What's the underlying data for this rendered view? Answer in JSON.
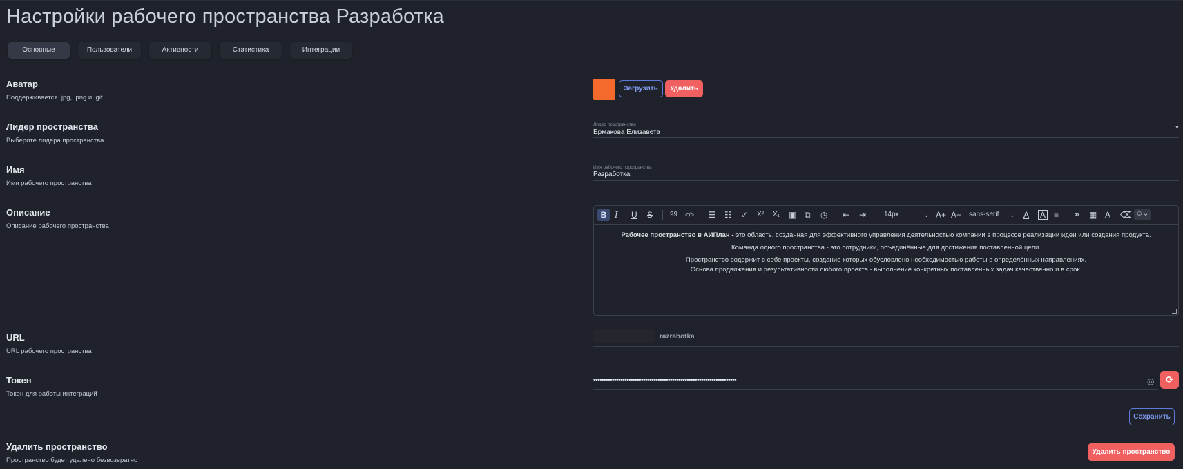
{
  "page": {
    "title": "Настройки рабочего пространства Разработка"
  },
  "tabs": [
    {
      "label": "Основные",
      "active": true
    },
    {
      "label": "Пользователи",
      "active": false
    },
    {
      "label": "Активности",
      "active": false
    },
    {
      "label": "Статистика",
      "active": false
    },
    {
      "label": "Интеграции",
      "active": false
    }
  ],
  "avatar": {
    "title": "Аватар",
    "desc": "Поддерживается .jpg, .png и .gif",
    "color": "#f46a2c",
    "upload_label": "Загрузить",
    "delete_label": "Удалить"
  },
  "leader": {
    "title": "Лидер пространства",
    "desc": "Выберите лидера пространства",
    "field_label": "Лидер пространства",
    "value": "Ермакова Елизавета"
  },
  "name": {
    "title": "Имя",
    "desc": "Имя рабочего пространства",
    "field_label": "Имя рабочего пространства",
    "value": "Разработка"
  },
  "description": {
    "title": "Описание",
    "desc": "Описание рабочего пространства",
    "toolbar": {
      "font_size": "14px",
      "font_family": "sans-serif",
      "icons": [
        "bold-icon",
        "italic-icon",
        "underline-icon",
        "strikethrough-icon",
        "quote-icon",
        "code-icon",
        "bullet-list-icon",
        "numbered-list-icon",
        "checklist-icon",
        "superscript-icon",
        "subscript-icon",
        "image-icon",
        "embed-icon",
        "clock-icon",
        "outdent-icon",
        "indent-icon",
        "increase-font-icon",
        "decrease-font-icon",
        "text-color-icon",
        "highlight-icon",
        "align-icon",
        "link-icon",
        "table-icon",
        "clear-format-icon",
        "eraser-icon",
        "emoji-icon"
      ]
    },
    "content": {
      "line1_bold": "Рабочее пространство в АИПлан -",
      "line1_rest": " это область, созданная для эффективного управления деятельностью компании в процессе реализации идеи или создания продукта.",
      "line2": "Команда одного пространства - это сотрудники, объединённые для достижения поставленной цели.",
      "line3": "Пространство содержит в себе проекты, создание которых обусловлено необходимостью работы в определённых направлениях.",
      "line4": "Основа продвижения и результативности любого проекта - выполнение конкретных поставленных задач качественно и в срок."
    }
  },
  "url": {
    "title": "URL",
    "desc": "URL рабочего пространства",
    "value": "razrabotka"
  },
  "token": {
    "title": "Токен",
    "desc": "Токен для работы интеграций",
    "value": "•••••••••••••••••••••••••••••••••••••••••••••••••••••••••••••••••••••"
  },
  "save_label": "Сохранить",
  "delete_space": {
    "title": "Удалить пространство",
    "desc": "Пространство будет удалено безвозвратно",
    "button_label": "Удалить пространство"
  }
}
